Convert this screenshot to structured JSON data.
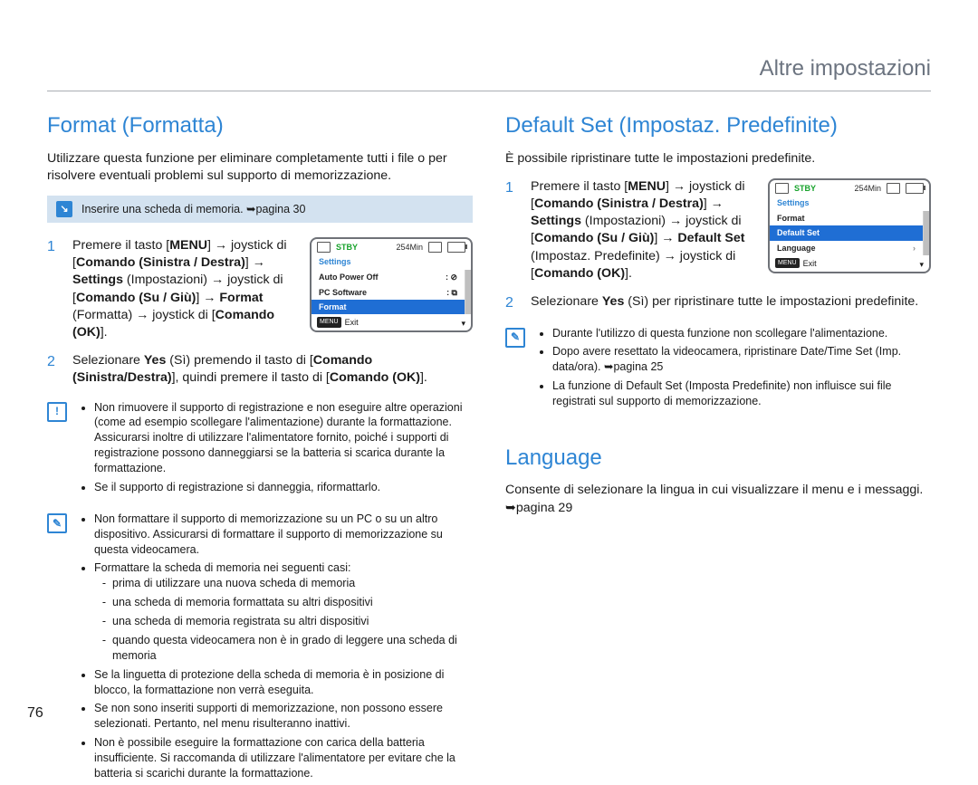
{
  "page_number": "76",
  "header": "Altre impostazioni",
  "left": {
    "title": "Format (Formatta)",
    "intro": "Utilizzare questa funzione per eliminare completamente tutti i file o per risolvere eventuali problemi sul supporto di memorizzazione.",
    "note_box": "Inserire una scheda di memoria. ➥pagina 30",
    "steps": {
      "one_parts": {
        "a": "Premere il tasto [",
        "menu": "MENU",
        "b": "] → joystick di [",
        "lr": "Comando (Sinistra / Destra)",
        "c": "] → ",
        "settings": "Settings",
        "d": " (Impostazioni) → joystick di [",
        "ud": "Comando (Su / Giù)",
        "e": "] → ",
        "format": "Format",
        "f": " (Formatta) → joystick di [",
        "ok": "Comando (OK)",
        "g": "]."
      },
      "two_parts": {
        "a": "Selezionare ",
        "yes": "Yes",
        "b": " (Sì) premendo il tasto di [",
        "lr": "Comando (Sinistra/Destra)",
        "c": "], quindi premere il tasto di [",
        "ok": "Comando (OK)",
        "d": "]."
      }
    },
    "warn_bullets": [
      "Non rimuovere il supporto di registrazione e non eseguire altre operazioni (come ad esempio scollegare l'alimentazione) durante la formattazione. Assicurarsi inoltre di utilizzare l'alimentatore fornito, poiché i supporti di registrazione possono danneggiarsi se la batteria si scarica durante la formattazione.",
      "Se il supporto di registrazione si danneggia, riformattarlo."
    ],
    "hint_bullets": [
      {
        "text": "Non formattare il supporto di memorizzazione su un PC o su un altro dispositivo. Assicurarsi di formattare il supporto di memorizzazione su questa videocamera."
      },
      {
        "text": "Formattare la scheda di memoria nei seguenti casi:",
        "sub": [
          "prima di utilizzare una nuova scheda di memoria",
          "una scheda di memoria formattata su altri dispositivi",
          "una scheda di memoria registrata su altri dispositivi",
          "quando questa videocamera non è in grado di leggere una scheda di memoria"
        ]
      },
      {
        "text": "Se la linguetta di protezione della scheda di memoria è in posizione di blocco, la formattazione non verrà eseguita."
      },
      {
        "text": "Se non sono inseriti supporti di memorizzazione, non possono essere selezionati. Pertanto, nel menu risulteranno inattivi."
      },
      {
        "text": "Non è possibile eseguire la formattazione con carica della batteria insufficiente. Si raccomanda di utilizzare l'alimentatore per evitare che la batteria si scarichi durante la formattazione."
      }
    ],
    "lcd": {
      "stby": "STBY",
      "time": "254Min",
      "title": "Settings",
      "items": [
        "Auto Power Off",
        "PC Software",
        "Format"
      ],
      "highlight_index": 2,
      "exit": "Exit"
    }
  },
  "right": {
    "title": "Default Set (Impostaz. Predefinite)",
    "intro": "È possibile ripristinare tutte le impostazioni predefinite.",
    "steps": {
      "one_parts": {
        "a": "Premere il tasto [",
        "menu": "MENU",
        "b": "] → joystick di [",
        "lr": "Comando (Sinistra / Destra)",
        "c": "] → ",
        "settings": "Settings",
        "d": " (Impostazioni) → joystick di [",
        "ud": "Comando (Su / Giù)",
        "e": "] → ",
        "ds": "Default Set",
        "f": " (Impostaz. Predefinite) → joystick di [",
        "ok": "Comando (OK)",
        "g": "]."
      },
      "two_parts": {
        "a": "Selezionare ",
        "yes": "Yes",
        "b": " (Sì) per ripristinare tutte le impostazioni predefinite."
      }
    },
    "hint_bullets": [
      "Durante l'utilizzo di questa funzione non scollegare l'alimentazione.",
      "Dopo avere resettato la videocamera, ripristinare Date/Time Set (Imp. data/ora). ➥pagina 25",
      "La funzione di Default Set (Imposta Predefinite) non influisce sui file registrati sul supporto di memorizzazione."
    ],
    "lcd": {
      "stby": "STBY",
      "time": "254Min",
      "title": "Settings",
      "items": [
        "Format",
        "Default Set",
        "Language"
      ],
      "highlight_index": 1,
      "exit": "Exit"
    },
    "language": {
      "title": "Language",
      "text": "Consente di selezionare la lingua in cui visualizzare il menu e i messaggi. ➥pagina 29"
    }
  }
}
